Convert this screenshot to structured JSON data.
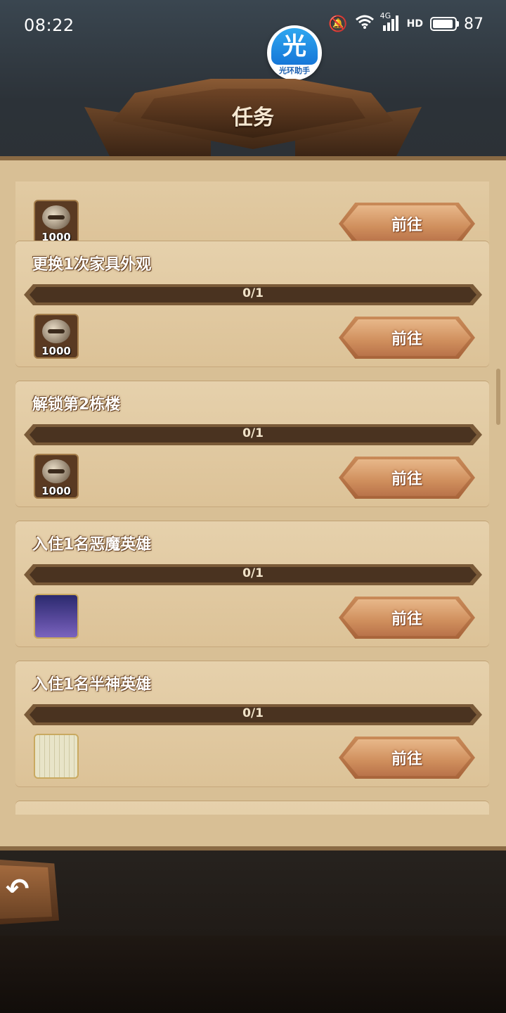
{
  "status_bar": {
    "time": "08:22",
    "network": "4G",
    "battery": "87"
  },
  "helper": {
    "glyph": "光",
    "caption": "光环助手"
  },
  "header": {
    "title": "任务"
  },
  "tasks": [
    {
      "title": "",
      "progress": "",
      "reward_type": "coin",
      "reward_amount": "1000",
      "button_label": "前往"
    },
    {
      "title": "更换1次家具外观",
      "progress": "0/1",
      "reward_type": "coin",
      "reward_amount": "1000",
      "button_label": "前往"
    },
    {
      "title": "解锁第2栋楼",
      "progress": "0/1",
      "reward_type": "coin",
      "reward_amount": "1000",
      "button_label": "前往"
    },
    {
      "title": "入住1名恶魔英雄",
      "progress": "0/1",
      "reward_type": "purple-item",
      "reward_amount": "",
      "button_label": "前往"
    },
    {
      "title": "入住1名半神英雄",
      "progress": "0/1",
      "reward_type": "cream-item",
      "reward_amount": "",
      "button_label": "前往"
    }
  ],
  "back_button": {
    "icon": "back-arrow-icon"
  }
}
